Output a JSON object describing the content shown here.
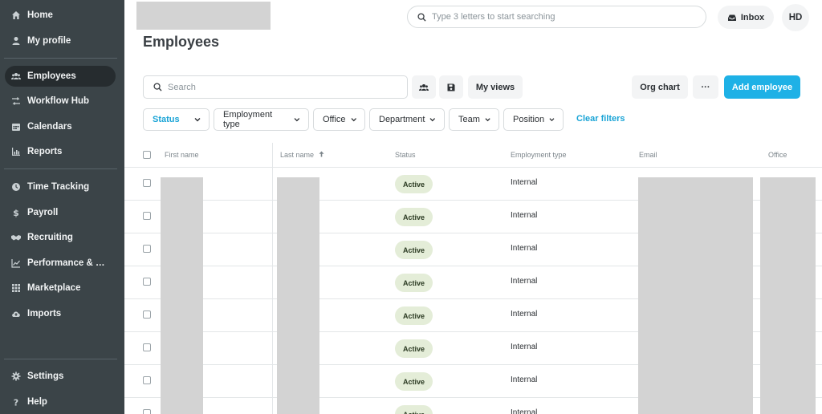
{
  "sidebar": {
    "items": [
      {
        "label": "Home",
        "icon": "home-icon"
      },
      {
        "label": "My profile",
        "icon": "user-icon"
      },
      {
        "label": "Employees",
        "icon": "people-icon",
        "active": true
      },
      {
        "label": "Workflow Hub",
        "icon": "workflow-icon"
      },
      {
        "label": "Calendars",
        "icon": "calendar-icon"
      },
      {
        "label": "Reports",
        "icon": "chart-icon"
      },
      {
        "label": "Time Tracking",
        "icon": "clock-icon"
      },
      {
        "label": "Payroll",
        "icon": "dollar-icon"
      },
      {
        "label": "Recruiting",
        "icon": "handshake-icon"
      },
      {
        "label": "Performance & D...",
        "icon": "trend-icon"
      },
      {
        "label": "Marketplace",
        "icon": "grid-icon"
      },
      {
        "label": "Imports",
        "icon": "cloud-upload-icon"
      },
      {
        "label": "Settings",
        "icon": "gear-icon"
      },
      {
        "label": "Help",
        "icon": "question-icon"
      }
    ]
  },
  "header": {
    "search_placeholder": "Type 3 letters to start searching",
    "inbox_label": "Inbox",
    "avatar_initials": "HD"
  },
  "page": {
    "title": "Employees"
  },
  "toolbar": {
    "search_placeholder": "Search",
    "my_views_label": "My views",
    "org_chart_label": "Org chart",
    "more_label": "···",
    "add_employee_label": "Add employee"
  },
  "filters": {
    "items": [
      "Status",
      "Employment type",
      "Office",
      "Department",
      "Team",
      "Position"
    ],
    "clear_label": "Clear filters"
  },
  "table": {
    "columns": [
      "First name",
      "Last name",
      "Status",
      "Employment type",
      "Email",
      "Office"
    ],
    "rows": [
      {
        "status": "Active",
        "employment_type": "Internal"
      },
      {
        "status": "Active",
        "employment_type": "Internal"
      },
      {
        "status": "Active",
        "employment_type": "Internal"
      },
      {
        "status": "Active",
        "employment_type": "Internal"
      },
      {
        "status": "Active",
        "employment_type": "Internal"
      },
      {
        "status": "Active",
        "employment_type": "Internal"
      },
      {
        "status": "Active",
        "employment_type": "Internal"
      },
      {
        "status": "Active",
        "employment_type": "Internal"
      }
    ]
  },
  "colors": {
    "sidebar_bg": "#3b4448",
    "accent": "#1eb1e6",
    "badge_bg": "#e4edd8"
  }
}
